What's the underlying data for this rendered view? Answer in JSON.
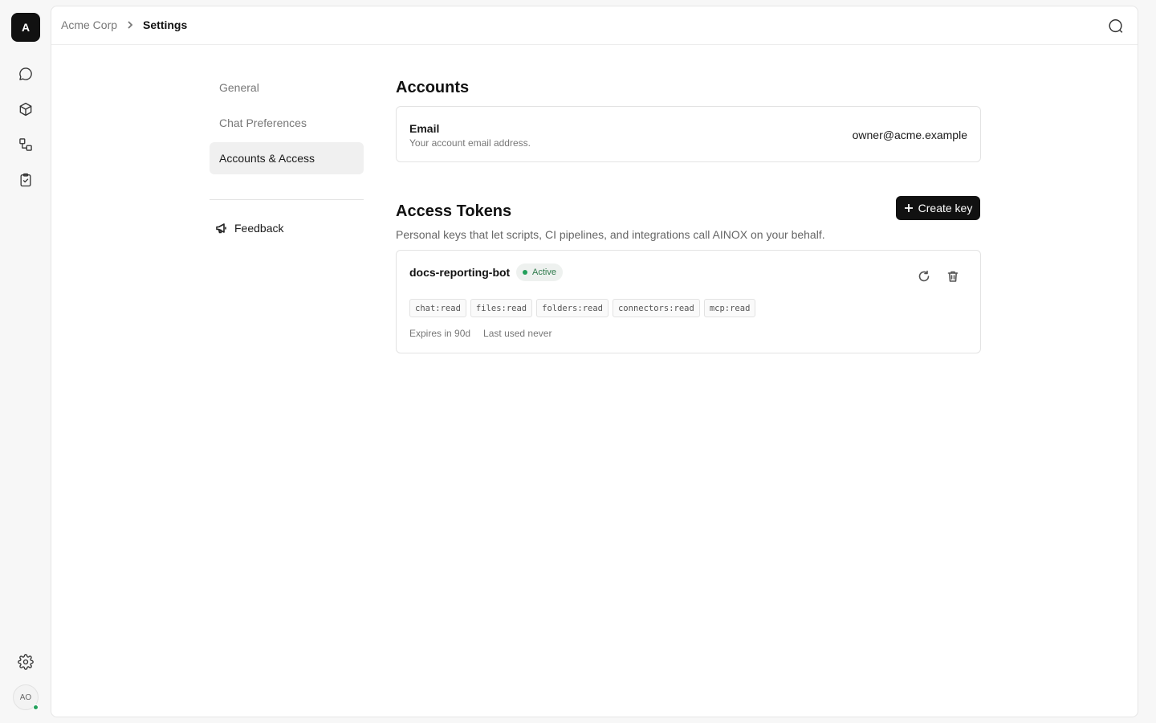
{
  "rail": {
    "logo_letter": "A",
    "avatar_initials": "AO"
  },
  "breadcrumb": {
    "org": "Acme Corp",
    "page": "Settings"
  },
  "settings_nav": {
    "items": [
      {
        "label": "General",
        "active": false
      },
      {
        "label": "Chat Preferences",
        "active": false
      },
      {
        "label": "Accounts & Access",
        "active": true
      }
    ],
    "feedback_label": "Feedback"
  },
  "accounts": {
    "heading": "Accounts",
    "email_label": "Email",
    "email_description": "Your account email address.",
    "email_value": "owner@acme.example"
  },
  "access_tokens": {
    "heading": "Access Tokens",
    "description": "Personal keys that let scripts, CI pipelines, and integrations call AINOX on your behalf.",
    "create_button_label": "Create key",
    "tokens": [
      {
        "name": "docs-reporting-bot",
        "status": "Active",
        "scopes": [
          "chat:read",
          "files:read",
          "folders:read",
          "connectors:read",
          "mcp:read"
        ],
        "expires": "Expires in 90d",
        "last_used": "Last used never"
      }
    ]
  },
  "colors": {
    "accent": "#111111",
    "status_active": "#22a05b",
    "status_text": "#2f7a4c"
  },
  "icons": [
    "chat-icon",
    "cube-icon",
    "workflow-icon",
    "clipboard-check-icon",
    "settings-icon",
    "search-icon",
    "chevron-right-icon",
    "megaphone-icon",
    "plus-icon",
    "refresh-icon",
    "trash-icon"
  ]
}
